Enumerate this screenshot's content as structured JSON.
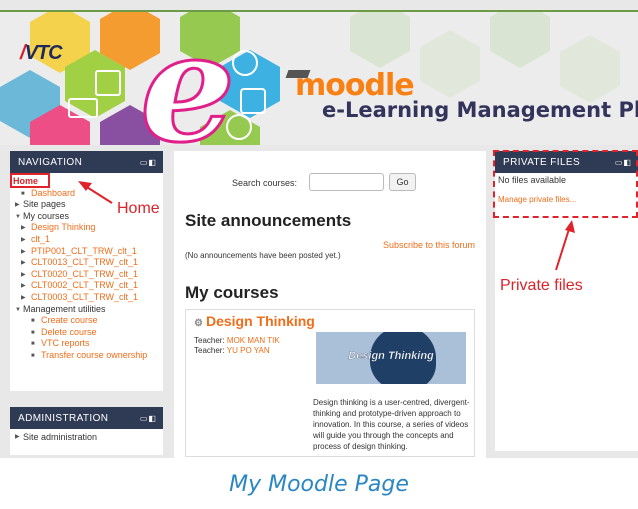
{
  "header": {
    "vtc_logo": "VTC",
    "moodle_logo": "moodle",
    "platform_title": "e-Learning Management Platform"
  },
  "navigation": {
    "title": "NAVIGATION",
    "items": [
      {
        "label": "Home"
      },
      {
        "label": "Dashboard"
      },
      {
        "label": "Site pages"
      },
      {
        "label": "My courses"
      },
      {
        "label": "Design Thinking"
      },
      {
        "label": "clt_1"
      },
      {
        "label": "PTIP001_CLT_TRW_clt_1"
      },
      {
        "label": "CLT0013_CLT_TRW_clt_1"
      },
      {
        "label": "CLT0020_CLT_TRW_clt_1"
      },
      {
        "label": "CLT0002_CLT_TRW_clt_1"
      },
      {
        "label": "CLT0003_CLT_TRW_clt_1"
      },
      {
        "label": "Management utilities"
      },
      {
        "label": "Create course"
      },
      {
        "label": "Delete course"
      },
      {
        "label": "VTC reports"
      },
      {
        "label": "Transfer course ownership"
      }
    ]
  },
  "administration": {
    "title": "ADMINISTRATION",
    "items": [
      {
        "label": "Site administration"
      }
    ]
  },
  "main": {
    "search_label": "Search courses:",
    "go_button": "Go",
    "site_announcements_title": "Site announcements",
    "subscribe_link": "Subscribe to this forum",
    "no_announcements": "(No announcements have been posted yet.)",
    "my_courses_title": "My courses",
    "course": {
      "name": "Design Thinking",
      "image_label": "Design Thinking",
      "teacher_label": "Teacher:",
      "teachers": [
        "MOK MAN TIK",
        "YU PO YAN"
      ],
      "description": "Design thinking is a user-centred, divergent-thinking and prototype-driven approach to innovation.  In this course, a series of videos will guide you through the concepts and process of design thinking."
    }
  },
  "private_files": {
    "title": "PRIVATE FILES",
    "none_text": "No files available",
    "manage_link": "Manage private files..."
  },
  "annotations": {
    "home": "Home",
    "private_files": "Private files"
  },
  "caption": "My Moodle Page",
  "colors": {
    "accent_link": "#f06d1a",
    "annotation_red": "#e0232b",
    "block_header": "#2f3a55",
    "caption_blue": "#2a87c4"
  }
}
